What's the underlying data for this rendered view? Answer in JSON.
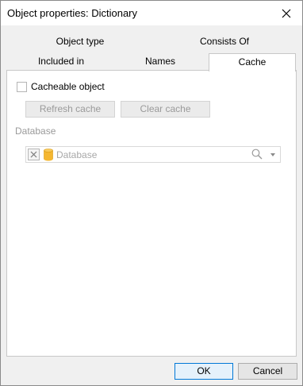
{
  "window": {
    "title": "Object properties: Dictionary"
  },
  "tabs": {
    "row1": [
      {
        "label": "Object type"
      },
      {
        "label": "Consists Of"
      }
    ],
    "row2": [
      {
        "label": "Included in"
      },
      {
        "label": "Names"
      },
      {
        "label": "Cache",
        "active": true
      }
    ]
  },
  "cache_tab": {
    "cacheable_label": "Cacheable object",
    "cacheable_checked": false,
    "refresh_label": "Refresh cache",
    "clear_label": "Clear cache",
    "database_section_label": "Database",
    "database_placeholder": "Database"
  },
  "footer": {
    "ok_label": "OK",
    "cancel_label": "Cancel"
  },
  "icons": {
    "close": "close-icon",
    "clear": "clear-x-icon",
    "database": "database-icon",
    "search": "search-icon",
    "dropdown": "chevron-down-icon"
  },
  "colors": {
    "accent": "#0078d7",
    "database_icon": "#f5b731",
    "disabled_text": "#9a9a9a"
  }
}
